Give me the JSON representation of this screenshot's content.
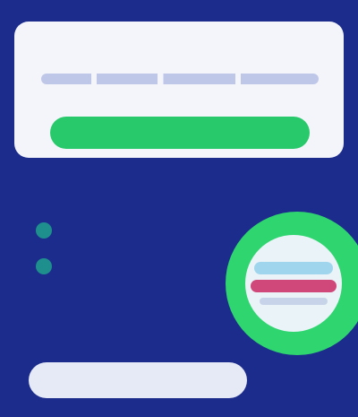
{
  "top_card": {
    "title": "",
    "button_label": ""
  },
  "stats": [
    {
      "label": "",
      "value": ""
    },
    {
      "label": "",
      "value": ""
    }
  ],
  "badge": {
    "text": ""
  },
  "footer": {
    "button_label": ""
  },
  "colors": {
    "background": "#1c2c8c",
    "card": "#f3f5fb",
    "accent_green": "#27c96a",
    "badge_green": "#2fd56f",
    "badge_pink": "#d0477a",
    "badge_blue": "#9fd6ee",
    "stat_dot": "#1e8f8c"
  }
}
